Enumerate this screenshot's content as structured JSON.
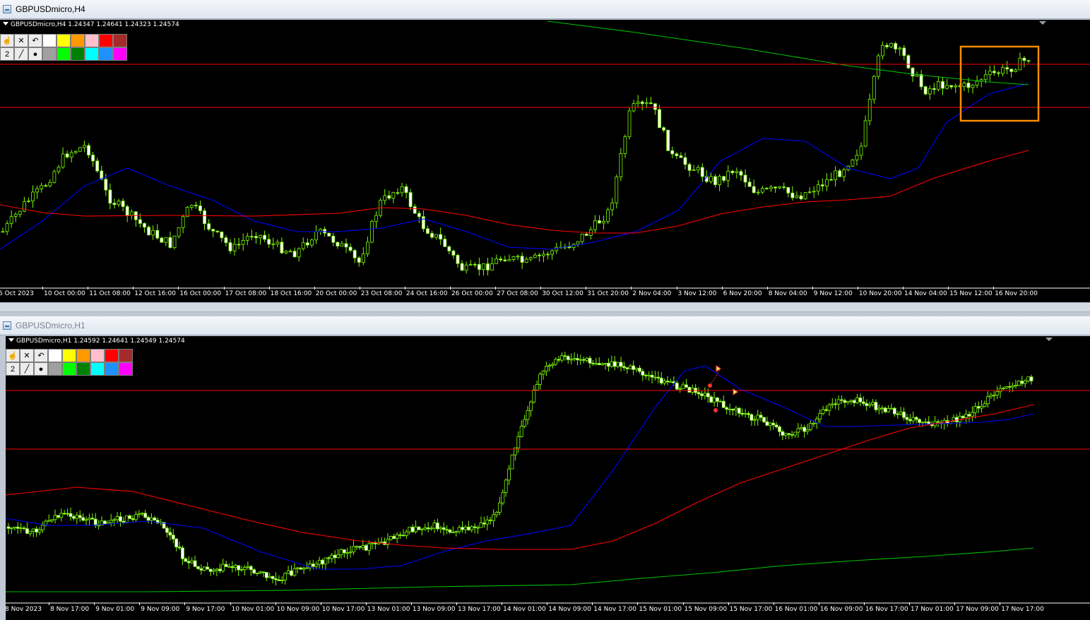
{
  "windows": [
    {
      "title": "GBPUSDmicro,H4",
      "info": "GBPUSDmicro,H4  1.24347 1.24641 1.24323 1.24574",
      "toolbar_num": "2",
      "swatches": [
        "#ffffff",
        "#ffff00",
        "#ff9900",
        "#ffc0cb",
        "#ff0000",
        "#a52a2a",
        "#a0a0a0",
        "#00ff00",
        "#008000",
        "#00ffff",
        "#1e90ff",
        "#ff00ff"
      ],
      "x_labels": [
        "6 Oct 2023",
        "10 Oct 00:00",
        "11 Oct 08:00",
        "12 Oct 16:00",
        "16 Oct 00:00",
        "17 Oct 08:00",
        "18 Oct 16:00",
        "20 Oct 00:00",
        "23 Oct 08:00",
        "24 Oct 16:00",
        "26 Oct 00:00",
        "27 Oct 08:00",
        "30 Oct 12:00",
        "31 Oct 20:00",
        "2 Nov 04:00",
        "3 Nov 12:00",
        "6 Nov 20:00",
        "8 Nov 04:00",
        "9 Nov 12:00",
        "10 Nov 20:00",
        "14 Nov 04:00",
        "15 Nov 12:00",
        "16 Nov 20:00"
      ]
    },
    {
      "title": "GBPUSDmicro,H1",
      "info": "GBPUSDmicro,H1  1.24592 1.24641 1.24549 1.24574",
      "toolbar_num": "2",
      "swatches": [
        "#ffffff",
        "#ffff00",
        "#ff9900",
        "#ffc0cb",
        "#ff0000",
        "#a52a2a",
        "#a0a0a0",
        "#00ff00",
        "#008000",
        "#00ffff",
        "#1e90ff",
        "#ff00ff"
      ],
      "x_labels": [
        "8 Nov 2023",
        "8 Nov 17:00",
        "9 Nov 01:00",
        "9 Nov 09:00",
        "9 Nov 17:00",
        "10 Nov 01:00",
        "10 Nov 09:00",
        "10 Nov 17:00",
        "13 Nov 01:00",
        "13 Nov 09:00",
        "13 Nov 17:00",
        "14 Nov 01:00",
        "14 Nov 09:00",
        "14 Nov 17:00",
        "15 Nov 01:00",
        "15 Nov 09:00",
        "15 Nov 17:00",
        "16 Nov 01:00",
        "16 Nov 09:00",
        "16 Nov 17:00",
        "17 Nov 01:00",
        "17 Nov 09:00",
        "17 Nov 17:00"
      ]
    }
  ],
  "colors": {
    "bull_candle": "#000000",
    "candle_outline": "#7cfc00",
    "fast_ma": "#0000ff",
    "slow_ma": "#ff0000",
    "long_ma": "#00c000",
    "hline": "#ff0000",
    "highlight_box": "#ff8c00"
  }
}
